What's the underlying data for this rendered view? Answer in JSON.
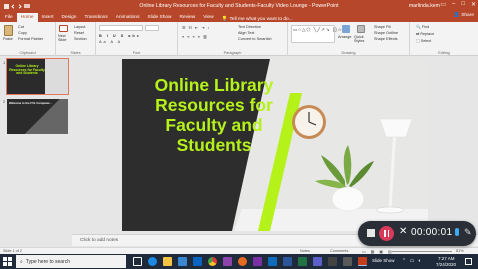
{
  "window": {
    "title": "Online Library Resources for Faculty and Students-Faculty Video Lounge - PowerPoint",
    "user": "marlinda.kem"
  },
  "tabs": [
    "File",
    "Home",
    "Insert",
    "Design",
    "Transitions",
    "Animations",
    "Slide Show",
    "Review",
    "View"
  ],
  "tell_me": "Tell me what you want to do...",
  "share": "Share",
  "ribbon": {
    "clipboard": {
      "label": "Clipboard",
      "paste": "Paste",
      "cut": "Cut",
      "copy": "Copy",
      "format_painter": "Format Painter"
    },
    "slides": {
      "label": "Slides",
      "new_slide": "New Slide",
      "layout": "Layout",
      "reset": "Reset",
      "section": "Section"
    },
    "font": {
      "label": "Font"
    },
    "paragraph": {
      "label": "Paragraph",
      "text_direction": "Text Direction",
      "align_text": "Align Text",
      "convert_smartart": "Convert to SmartArt"
    },
    "drawing": {
      "label": "Drawing",
      "arrange": "Arrange",
      "quick_styles": "Quick Styles",
      "shape_fill": "Shape Fill",
      "shape_outline": "Shape Outline",
      "shape_effects": "Shape Effects"
    },
    "editing": {
      "label": "Editing",
      "find": "Find",
      "replace": "Replace",
      "select": "Select"
    }
  },
  "thumbnails": [
    {
      "number": "1",
      "text": "Online Library Resources for Faculty and Students",
      "selected": true
    },
    {
      "number": "2",
      "text": "Welcome to the FVL Computer...",
      "selected": false
    }
  ],
  "slide": {
    "title_lines": [
      "Online Library",
      "Resources for",
      "Faculty and",
      "Students"
    ],
    "accent": "#b5f21a"
  },
  "notes_placeholder": "Click to add notes",
  "status": {
    "slide_count": "Slide 1 of 2",
    "notes": "Notes",
    "comments": "Comments",
    "zoom": "81%"
  },
  "taskbar": {
    "search_placeholder": "Type here to search",
    "time": "7:27 AM",
    "date": "7/24/2020",
    "slide_show_label": "Slide Show"
  },
  "recorder": {
    "elapsed": "00:00:01"
  },
  "colors": {
    "powerpoint_red": "#b7472a",
    "accent_green": "#b5f21a"
  }
}
